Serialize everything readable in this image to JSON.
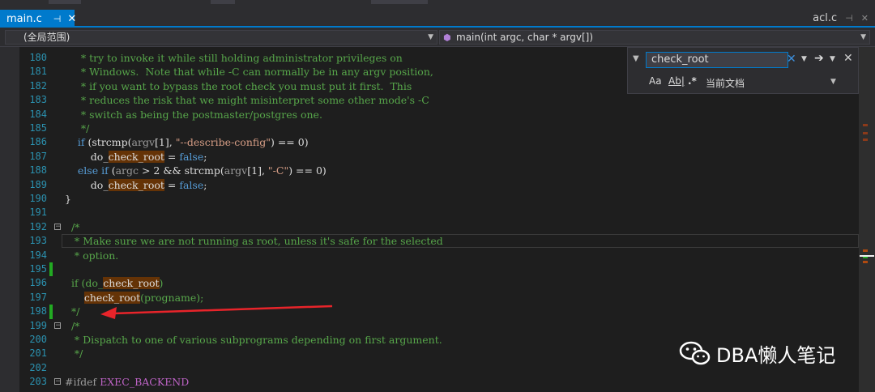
{
  "tabs": {
    "active": {
      "label": "main.c",
      "pin": "⊣",
      "close": "✕"
    },
    "right": {
      "label": "acl.c",
      "pin": "⊣",
      "close": "✕"
    }
  },
  "nav": {
    "scope": "(全局范围)",
    "func_icon": "⬢",
    "func": "main(int argc, char * argv[])"
  },
  "find": {
    "query": "check_root",
    "clear": "✕",
    "go": "➔",
    "close": "✕",
    "opt_case": "Aa",
    "opt_word": "Ab|",
    "opt_regex": ".*",
    "scope": "当前文档"
  },
  "lines": [
    {
      "n": "180",
      "parts": [
        {
          "c": "cm",
          "t": "     * try to invoke it while still holding administrator privileges on"
        }
      ]
    },
    {
      "n": "181",
      "parts": [
        {
          "c": "cm",
          "t": "     * Windows.  Note that while -C can normally be in any argv position,"
        }
      ]
    },
    {
      "n": "182",
      "parts": [
        {
          "c": "cm",
          "t": "     * if you want to bypass the root check you must put it first.  This"
        }
      ]
    },
    {
      "n": "183",
      "parts": [
        {
          "c": "cm",
          "t": "     * reduces the risk that we might misinterpret some other mode's -C"
        }
      ]
    },
    {
      "n": "184",
      "parts": [
        {
          "c": "cm",
          "t": "     * switch as being the postmaster/postgres one."
        }
      ]
    },
    {
      "n": "185",
      "parts": [
        {
          "c": "cm",
          "t": "     */"
        }
      ]
    },
    {
      "n": "186",
      "parts": [
        {
          "c": "",
          "t": "    "
        },
        {
          "c": "kw",
          "t": "if"
        },
        {
          "c": "",
          "t": " (strcmp("
        },
        {
          "c": "pp",
          "t": "argv"
        },
        {
          "c": "",
          "t": "[1], "
        },
        {
          "c": "str",
          "t": "\"--describe-config\""
        },
        {
          "c": "",
          "t": ") == 0)"
        }
      ]
    },
    {
      "n": "187",
      "parts": [
        {
          "c": "",
          "t": "        do_"
        },
        {
          "c": "hl",
          "t": "check_root"
        },
        {
          "c": "",
          "t": " = "
        },
        {
          "c": "kw",
          "t": "false"
        },
        {
          "c": "",
          "t": ";"
        }
      ]
    },
    {
      "n": "188",
      "parts": [
        {
          "c": "",
          "t": "    "
        },
        {
          "c": "kw",
          "t": "else if"
        },
        {
          "c": "",
          "t": " ("
        },
        {
          "c": "pp",
          "t": "argc"
        },
        {
          "c": "",
          "t": " > 2 && strcmp("
        },
        {
          "c": "pp",
          "t": "argv"
        },
        {
          "c": "",
          "t": "[1], "
        },
        {
          "c": "str",
          "t": "\"-C\""
        },
        {
          "c": "",
          "t": ") == 0)"
        }
      ]
    },
    {
      "n": "189",
      "parts": [
        {
          "c": "",
          "t": "        do_"
        },
        {
          "c": "hl",
          "t": "check_root"
        },
        {
          "c": "",
          "t": " = "
        },
        {
          "c": "kw",
          "t": "false"
        },
        {
          "c": "",
          "t": ";"
        }
      ]
    },
    {
      "n": "190",
      "parts": [
        {
          "c": "",
          "t": "}"
        }
      ]
    },
    {
      "n": "191",
      "parts": [
        {
          "c": "",
          "t": ""
        }
      ]
    },
    {
      "n": "192",
      "fold": "⊟",
      "parts": [
        {
          "c": "cm",
          "t": "  /*"
        }
      ]
    },
    {
      "n": "193",
      "parts": [
        {
          "c": "cm",
          "t": "   * Make sure we are not running as root, unless it's safe for the selected"
        }
      ]
    },
    {
      "n": "194",
      "parts": [
        {
          "c": "cm",
          "t": "   * option."
        }
      ]
    },
    {
      "n": "195",
      "chg": true,
      "parts": [
        {
          "c": "",
          "t": ""
        }
      ]
    },
    {
      "n": "196",
      "parts": [
        {
          "c": "cm",
          "t": "  if (do_"
        },
        {
          "c": "hlf",
          "t": "check_root"
        },
        {
          "c": "cm",
          "t": ")"
        }
      ]
    },
    {
      "n": "197",
      "parts": [
        {
          "c": "cm",
          "t": "      "
        },
        {
          "c": "hlf",
          "t": "check_root"
        },
        {
          "c": "cm",
          "t": "(progname);"
        }
      ]
    },
    {
      "n": "198",
      "chg": true,
      "parts": [
        {
          "c": "cm",
          "t": "  */"
        }
      ]
    },
    {
      "n": "199",
      "fold": "⊟",
      "parts": [
        {
          "c": "cm",
          "t": "  /*"
        }
      ]
    },
    {
      "n": "200",
      "parts": [
        {
          "c": "cm",
          "t": "   * Dispatch to one of various subprograms depending on first argument."
        }
      ]
    },
    {
      "n": "201",
      "parts": [
        {
          "c": "cm",
          "t": "   */"
        }
      ]
    },
    {
      "n": "202",
      "parts": [
        {
          "c": "",
          "t": ""
        }
      ]
    },
    {
      "n": "203",
      "fold": "⊟",
      "parts": [
        {
          "c": "pp",
          "t": "#ifdef "
        },
        {
          "c": "mac",
          "t": "EXEC_BACKEND"
        }
      ]
    }
  ],
  "watermark": "DBA懒人笔记",
  "colors": {
    "accent": "#007acc",
    "highlight": "#653306",
    "comment": "#57a64a",
    "keyword": "#569cd6",
    "arrow": "#e8242a"
  }
}
